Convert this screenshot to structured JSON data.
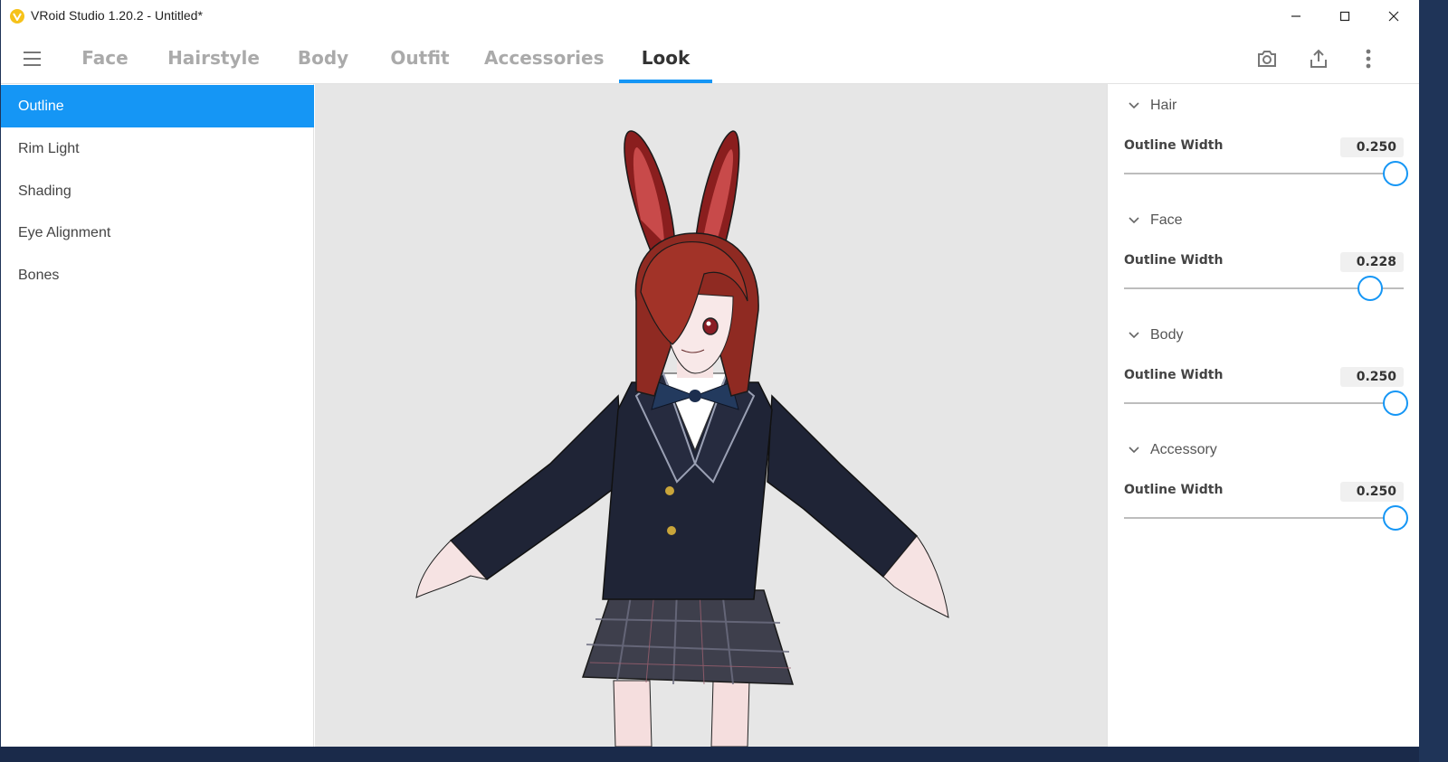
{
  "window": {
    "title": "VRoid Studio 1.20.2 - Untitled*"
  },
  "menubar": {
    "tabs": [
      {
        "label": "Face"
      },
      {
        "label": "Hairstyle"
      },
      {
        "label": "Body"
      },
      {
        "label": "Outfit"
      },
      {
        "label": "Accessories"
      },
      {
        "label": "Look",
        "active": true
      }
    ],
    "icons": [
      "camera-icon",
      "export-icon",
      "more-vertical-icon"
    ]
  },
  "sidebar": {
    "items": [
      {
        "label": "Outline",
        "active": true
      },
      {
        "label": "Rim Light"
      },
      {
        "label": "Shading"
      },
      {
        "label": "Eye Alignment"
      },
      {
        "label": "Bones"
      }
    ]
  },
  "panel": {
    "sections": [
      {
        "title": "Hair",
        "label": "Outline Width",
        "value": "0.250",
        "fraction": 0.97
      },
      {
        "title": "Face",
        "label": "Outline Width",
        "value": "0.228",
        "fraction": 0.88
      },
      {
        "title": "Body",
        "label": "Outline Width",
        "value": "0.250",
        "fraction": 0.97
      },
      {
        "title": "Accessory",
        "label": "Outline Width",
        "value": "0.250",
        "fraction": 0.97
      }
    ]
  },
  "colors": {
    "accent": "#1596f5",
    "logo": "#f6c21a",
    "viewport_bg": "#e6e6e6"
  }
}
